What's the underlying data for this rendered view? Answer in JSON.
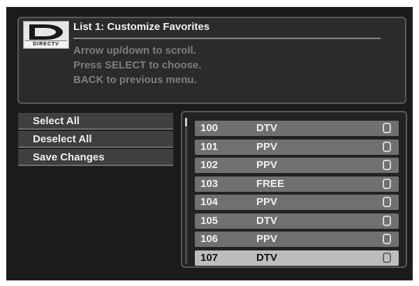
{
  "header": {
    "logo_text": "DIRECTV",
    "title": "List 1: Customize Favorites",
    "instructions": [
      "Arrow up/down to scroll.",
      "Press SELECT to choose.",
      "BACK to previous menu."
    ]
  },
  "menu": {
    "items": [
      {
        "label": "Select All"
      },
      {
        "label": "Deselect All"
      },
      {
        "label": "Save Changes"
      }
    ]
  },
  "channel_list": {
    "rows": [
      {
        "channel": "100",
        "type": "DTV",
        "checked": false
      },
      {
        "channel": "101",
        "type": "PPV",
        "checked": false
      },
      {
        "channel": "102",
        "type": "PPV",
        "checked": false
      },
      {
        "channel": "103",
        "type": "FREE",
        "checked": false
      },
      {
        "channel": "104",
        "type": "PPV",
        "checked": false
      },
      {
        "channel": "105",
        "type": "DTV",
        "checked": false
      },
      {
        "channel": "106",
        "type": "PPV",
        "checked": false
      },
      {
        "channel": "107",
        "type": "DTV",
        "checked": false,
        "highlighted": true
      }
    ]
  },
  "colors": {
    "background": "#1b1b1b",
    "row": "#707070",
    "row_highlight": "#bdbdbd",
    "text": "#f0f0f0",
    "instruction_text": "#7e7e7e"
  }
}
